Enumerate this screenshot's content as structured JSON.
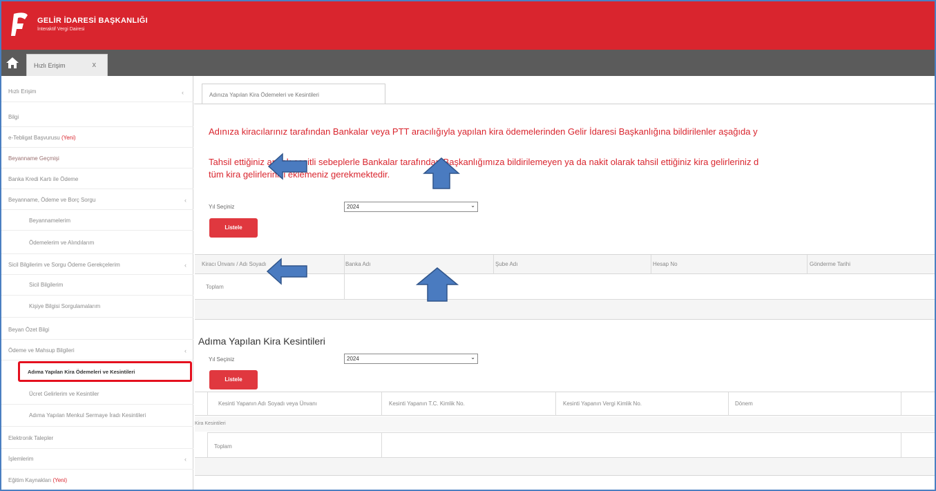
{
  "header": {
    "brand_title": "GELİR İDARESİ BAŞKANLIĞI",
    "brand_subtitle": "İnteraktif Vergi Dairesi"
  },
  "tabs": {
    "user_tab_label": "Hızlı Erişim",
    "user_tab_close": "x"
  },
  "sidebar": {
    "items": [
      {
        "label": "Hızlı Erişim",
        "chev": "‹"
      },
      {
        "label": "Bilgi"
      },
      {
        "label": "e-Tebligat Başvurusu ",
        "badge": "(Yeni)"
      },
      {
        "label": "Beyanname Geçmişi"
      },
      {
        "label": "Banka Kredi Kartı ile Ödeme"
      },
      {
        "label": "Beyanname, Ödeme ve Borç Sorgu",
        "chev": "‹"
      },
      {
        "label": "Beyannamelerim"
      },
      {
        "label": "Ödemelerim ve Alındılarım"
      },
      {
        "label": "Sicil Bilgilerim ve Sorgu Ödeme Gerekçelerim",
        "chev": "‹"
      },
      {
        "label": "Sicil Bilgilerim"
      },
      {
        "label": "Kişiye Bilgisi Sorgulamalarım"
      },
      {
        "label": "Beyan Özet Bilgi"
      },
      {
        "label": "Ödeme ve Mahsup Bilgileri",
        "chev": "‹"
      },
      {
        "label": "Adıma Yapılan Kira Ödemeleri ve Kesintileri"
      },
      {
        "label": "Ücret Gelirlerim ve Kesintiler"
      },
      {
        "label": "Adıma Yapılan Menkul Sermaye İradı Kesintileri"
      },
      {
        "label": "Elektronik Talepler"
      },
      {
        "label": "İşlemlerim",
        "chev": "‹"
      },
      {
        "label": "Eğitim Kaynakları ",
        "badge": "(Yeni)"
      }
    ]
  },
  "main": {
    "tab_label": "Adınıza Yapılan Kira Ödemeleri ve Kesintileri",
    "notice_1": "Adınıza kiracılarınız tarafından Bankalar veya PTT aracılığıyla yapılan kira ödemelerinden Gelir İdaresi Başkanlığına bildirilenler aşağıda y",
    "notice_2": "Tahsil ettiğiniz ancak çeşitli sebeplerle Bankalar tarafından Başkanlığımıza bildirilemeyen ya da nakit olarak tahsil ettiğiniz kira gelirleriniz d",
    "notice_3": "tüm kira gelirlerinizi eklemeniz gerekmektedir.",
    "year_label": "Yıl Seçiniz",
    "year_value": "2024",
    "list_button": "Listele",
    "table1": {
      "headers": [
        "Kiracı Ünvanı / Adı Soyadı",
        "Banka Adı",
        "Şube Adı",
        "Hesap No",
        "Gönderme Tarihi"
      ],
      "total_label": "Toplam"
    },
    "section2_title": "Adıma Yapılan Kira Kesintileri",
    "year_label_2": "Yıl Seçiniz",
    "year_value_2": "2024",
    "list_button_2": "Listele",
    "table2": {
      "headers": [
        "Kesinti Yapanın Adı Soyadı veya Ünvanı",
        "Kesinti Yapanın T.C. Kimlik No.",
        "Kesinti Yapanın Vergi Kimlik No.",
        "Dönem"
      ],
      "group_label": "Kira Kesintileri",
      "total_label": "Toplam"
    }
  },
  "colors": {
    "brand_red": "#d9252e",
    "arrow_blue": "#4a7bc0",
    "highlight_red": "#e4101e"
  }
}
